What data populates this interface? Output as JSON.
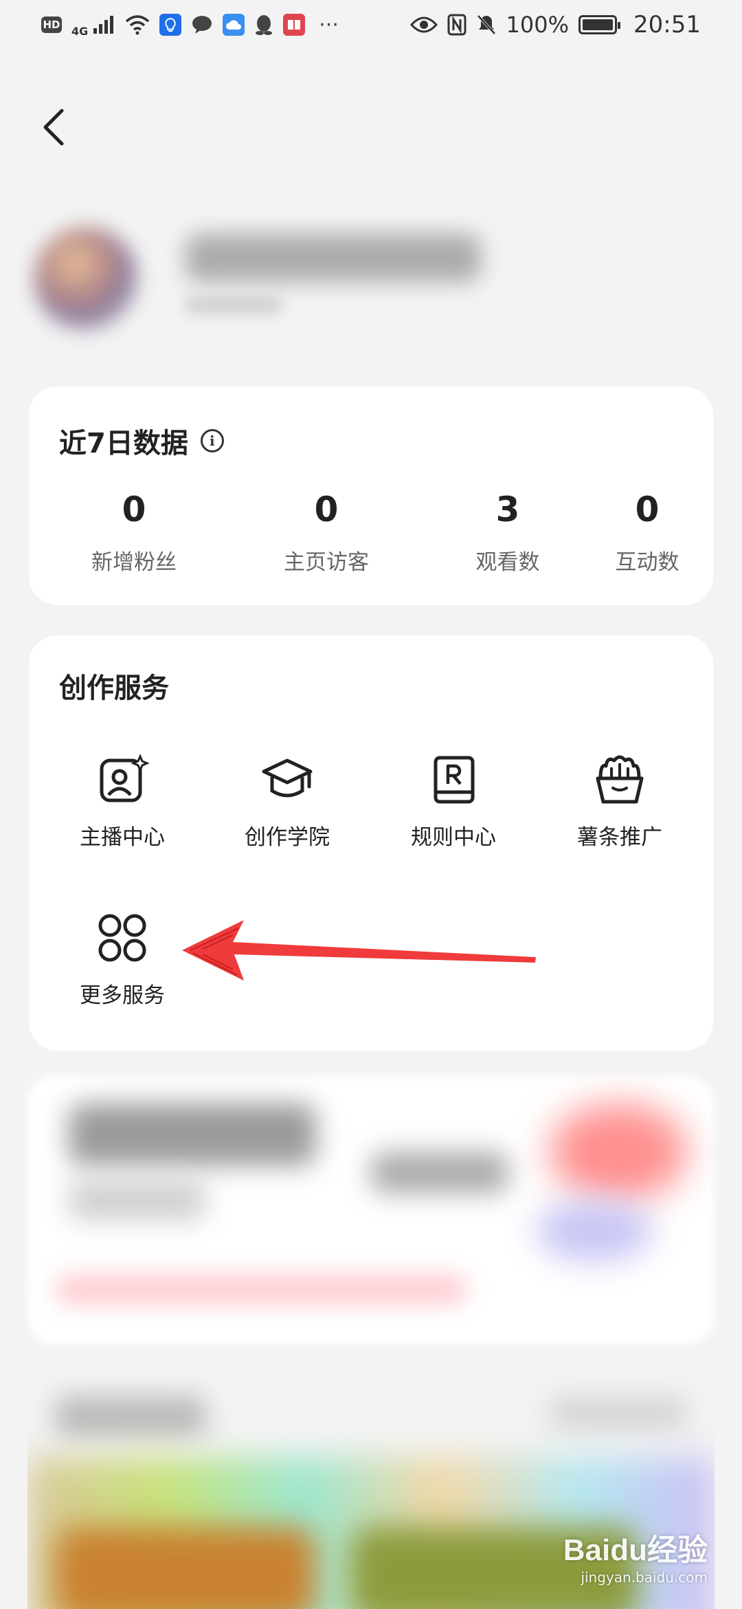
{
  "status_bar": {
    "network": "4G",
    "battery_percent": "100%",
    "time": "20:51"
  },
  "recent_data": {
    "title": "近7日数据",
    "stats": [
      {
        "value": "0",
        "label": "新增粉丝"
      },
      {
        "value": "0",
        "label": "主页访客"
      },
      {
        "value": "3",
        "label": "观看数"
      },
      {
        "value": "0",
        "label": "互动数"
      }
    ]
  },
  "services": {
    "title": "创作服务",
    "items": [
      {
        "label": "主播中心",
        "icon": "anchor-center-icon"
      },
      {
        "label": "创作学院",
        "icon": "graduation-cap-icon"
      },
      {
        "label": "规则中心",
        "icon": "rules-book-icon"
      },
      {
        "label": "薯条推广",
        "icon": "fries-icon"
      },
      {
        "label": "更多服务",
        "icon": "grid-circles-icon"
      }
    ]
  },
  "annotation": {
    "color": "#ef3b3b"
  },
  "watermark": {
    "logo": "Baidu经验",
    "url": "jingyan.baidu.com"
  }
}
